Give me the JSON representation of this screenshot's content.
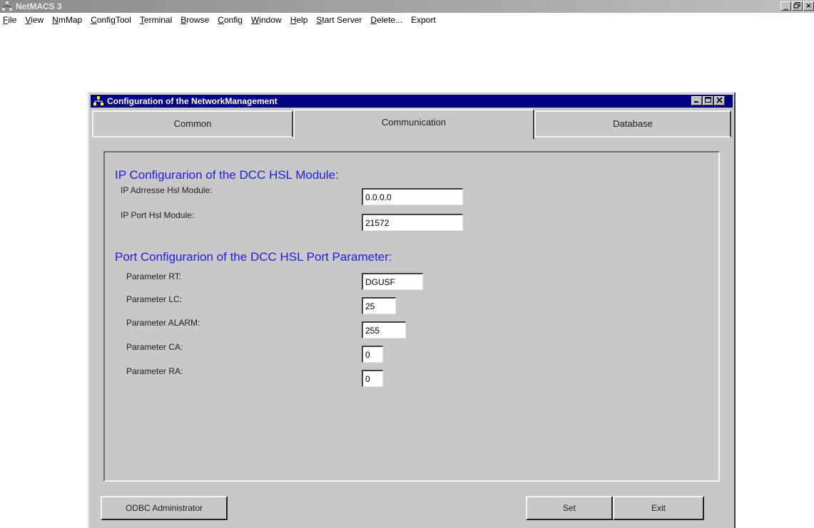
{
  "app": {
    "title": "NetMACS 3",
    "controls": {
      "minimize": "_",
      "maximize": "ő",
      "close": "×"
    }
  },
  "menu": [
    {
      "label": "File",
      "key": "F",
      "rest": "ile"
    },
    {
      "label": "View",
      "key": "V",
      "rest": "iew"
    },
    {
      "label": "NmMap",
      "key": "N",
      "rest": "mMap"
    },
    {
      "label": "ConfigTool",
      "key": "C",
      "rest": "onfigTool"
    },
    {
      "label": "Terminal",
      "key": "T",
      "rest": "erminal"
    },
    {
      "label": "Browse",
      "key": "B",
      "rest": "rowse"
    },
    {
      "label": "Config",
      "key": "C",
      "rest": "onfig"
    },
    {
      "label": "Window",
      "key": "W",
      "rest": "indow"
    },
    {
      "label": "Help",
      "key": "H",
      "rest": "elp"
    },
    {
      "label": "Start Server",
      "key": "S",
      "rest": "tart Server"
    },
    {
      "label": "Delete...",
      "key": "D",
      "rest": "elete..."
    },
    {
      "label": "Export",
      "key": "",
      "rest": "Export"
    }
  ],
  "dialog": {
    "title": "Configuration of the NetworkManagement",
    "tabs": {
      "common": "Common",
      "communication": "Communication",
      "database": "Database"
    },
    "ip_section": {
      "header": "IP Configurarion of the DCC HSL Module:",
      "address_label": "IP Adrresse Hsl Module:",
      "address_value": "0.0.0.0",
      "port_label": "IP Port Hsl Module:",
      "port_value": "21572"
    },
    "port_section": {
      "header": "Port Configurarion of the DCC HSL Port Parameter:",
      "rt_label": "Parameter RT:",
      "rt_value": "DGUSF",
      "lc_label": "Parameter LC:",
      "lc_value": "25",
      "alarm_label": "Parameter ALARM:",
      "alarm_value": "255",
      "ca_label": "Parameter CA:",
      "ca_value": "0",
      "ra_label": "Parameter RA:",
      "ra_value": "0"
    },
    "buttons": {
      "odbc": "ODBC Administrator",
      "set": "Set",
      "exit": "Exit"
    }
  },
  "icons": {
    "app": "network-icon",
    "dialog": "network-icon"
  },
  "colors": {
    "dialog_title_bg": "#000080",
    "section_header": "#2020e0",
    "surface": "#c8c8c8"
  }
}
